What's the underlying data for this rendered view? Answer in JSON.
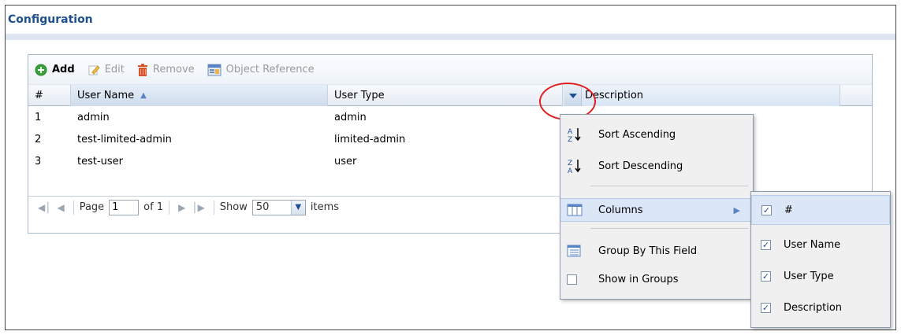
{
  "section_title": "Configuration",
  "toolbar": {
    "add_label": "Add",
    "edit_label": "Edit",
    "remove_label": "Remove",
    "object_reference_label": "Object Reference"
  },
  "table": {
    "columns": [
      "#",
      "User Name",
      "User Type",
      "Description"
    ],
    "rows": [
      {
        "num": "1",
        "user_name": "admin",
        "user_type": "admin",
        "description": ""
      },
      {
        "num": "2",
        "user_name": "test-limited-admin",
        "user_type": "limited-admin",
        "description": ""
      },
      {
        "num": "3",
        "user_name": "test-user",
        "user_type": "user",
        "description": ""
      }
    ]
  },
  "pager": {
    "page_label": "Page",
    "page_value": "1",
    "of_label": "of 1",
    "show_label": "Show",
    "show_value": "50",
    "items_label": "items"
  },
  "column_menu": {
    "sort_ascending": "Sort Ascending",
    "sort_descending": "Sort Descending",
    "columns": "Columns",
    "group_by": "Group By This Field",
    "show_in_groups": "Show in Groups"
  },
  "columns_submenu": [
    {
      "label": "#",
      "checked": true
    },
    {
      "label": "User Name",
      "checked": true
    },
    {
      "label": "User Type",
      "checked": true
    },
    {
      "label": "Description",
      "checked": true
    }
  ],
  "colors": {
    "title": "#1d4f91",
    "highlight_circle": "#e02020",
    "add_icon": "#3aa33a",
    "remove_icon": "#d9532b"
  }
}
